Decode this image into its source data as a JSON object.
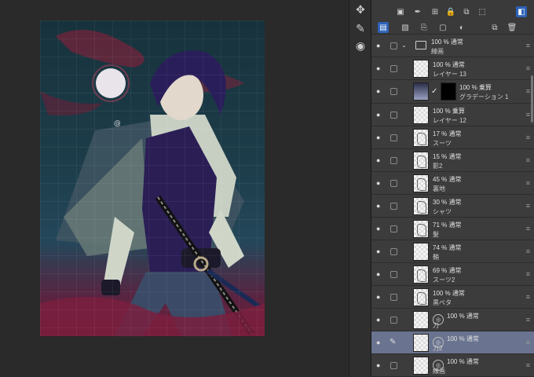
{
  "colors": {
    "panel_bg": "#363636",
    "row_bg": "#3c3c3c",
    "selected_row": "#6a7490",
    "accent": "#2e62b8"
  },
  "tools": {
    "items": [
      "move-layer-icon",
      "pen-icon",
      "layer-property-icon"
    ]
  },
  "panel_toolbar": {
    "icons": [
      "new-raster-icon",
      "new-vector-icon",
      "new-folder-icon",
      "lock-icon",
      "mask-icon",
      "blend-icon",
      "color-swap-icon"
    ],
    "row2_icons": [
      "reference-icon",
      "layer-color-icon",
      "clip-icon",
      "paper-icon",
      "mask-apply-icon",
      "duplicate-icon",
      "delete-icon"
    ]
  },
  "layers": [
    {
      "kind": "folder",
      "line1": "100 % 通常",
      "line2": "線画"
    },
    {
      "kind": "layer",
      "line1": "100 % 通常",
      "line2": "レイヤー 13"
    },
    {
      "kind": "gradient",
      "line1": "100 % 乗算",
      "line2": "グラデーション 1"
    },
    {
      "kind": "layer",
      "line1": "100 % 乗算",
      "line2": "レイヤー 12"
    },
    {
      "kind": "layer",
      "line1": "17 % 通常",
      "line2": "スーツ"
    },
    {
      "kind": "layer",
      "line1": "15 % 通常",
      "line2": "影2"
    },
    {
      "kind": "layer",
      "line1": "45 % 通常",
      "line2": "裏地"
    },
    {
      "kind": "layer",
      "line1": "30 % 通常",
      "line2": "シャツ"
    },
    {
      "kind": "layer",
      "line1": "71 % 通常",
      "line2": "髪"
    },
    {
      "kind": "layer",
      "line1": "74 % 通常",
      "line2": "鞘"
    },
    {
      "kind": "layer",
      "line1": "69 % 通常",
      "line2": "スーツ2"
    },
    {
      "kind": "layer",
      "line1": "100 % 通常",
      "line2": "黒ベタ"
    },
    {
      "kind": "vector",
      "line1": "100 % 通常",
      "line2": "刀"
    },
    {
      "kind": "vector-selected",
      "line1": "100 % 通常",
      "line2": "刀2"
    },
    {
      "kind": "vector",
      "line1": "100 % 通常",
      "line2": "線画"
    }
  ]
}
